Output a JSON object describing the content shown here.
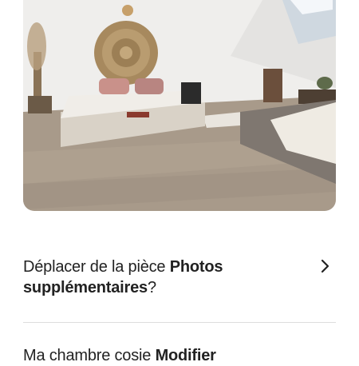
{
  "move_prompt": {
    "prefix": "Déplacer de la pièce ",
    "room_name": "Photos supplémentaires",
    "suffix": "?"
  },
  "next_room": {
    "prefix": "Ma chambre cosie ",
    "action": "Modifier"
  },
  "icons": {
    "chevron": "chevron-right-icon"
  }
}
